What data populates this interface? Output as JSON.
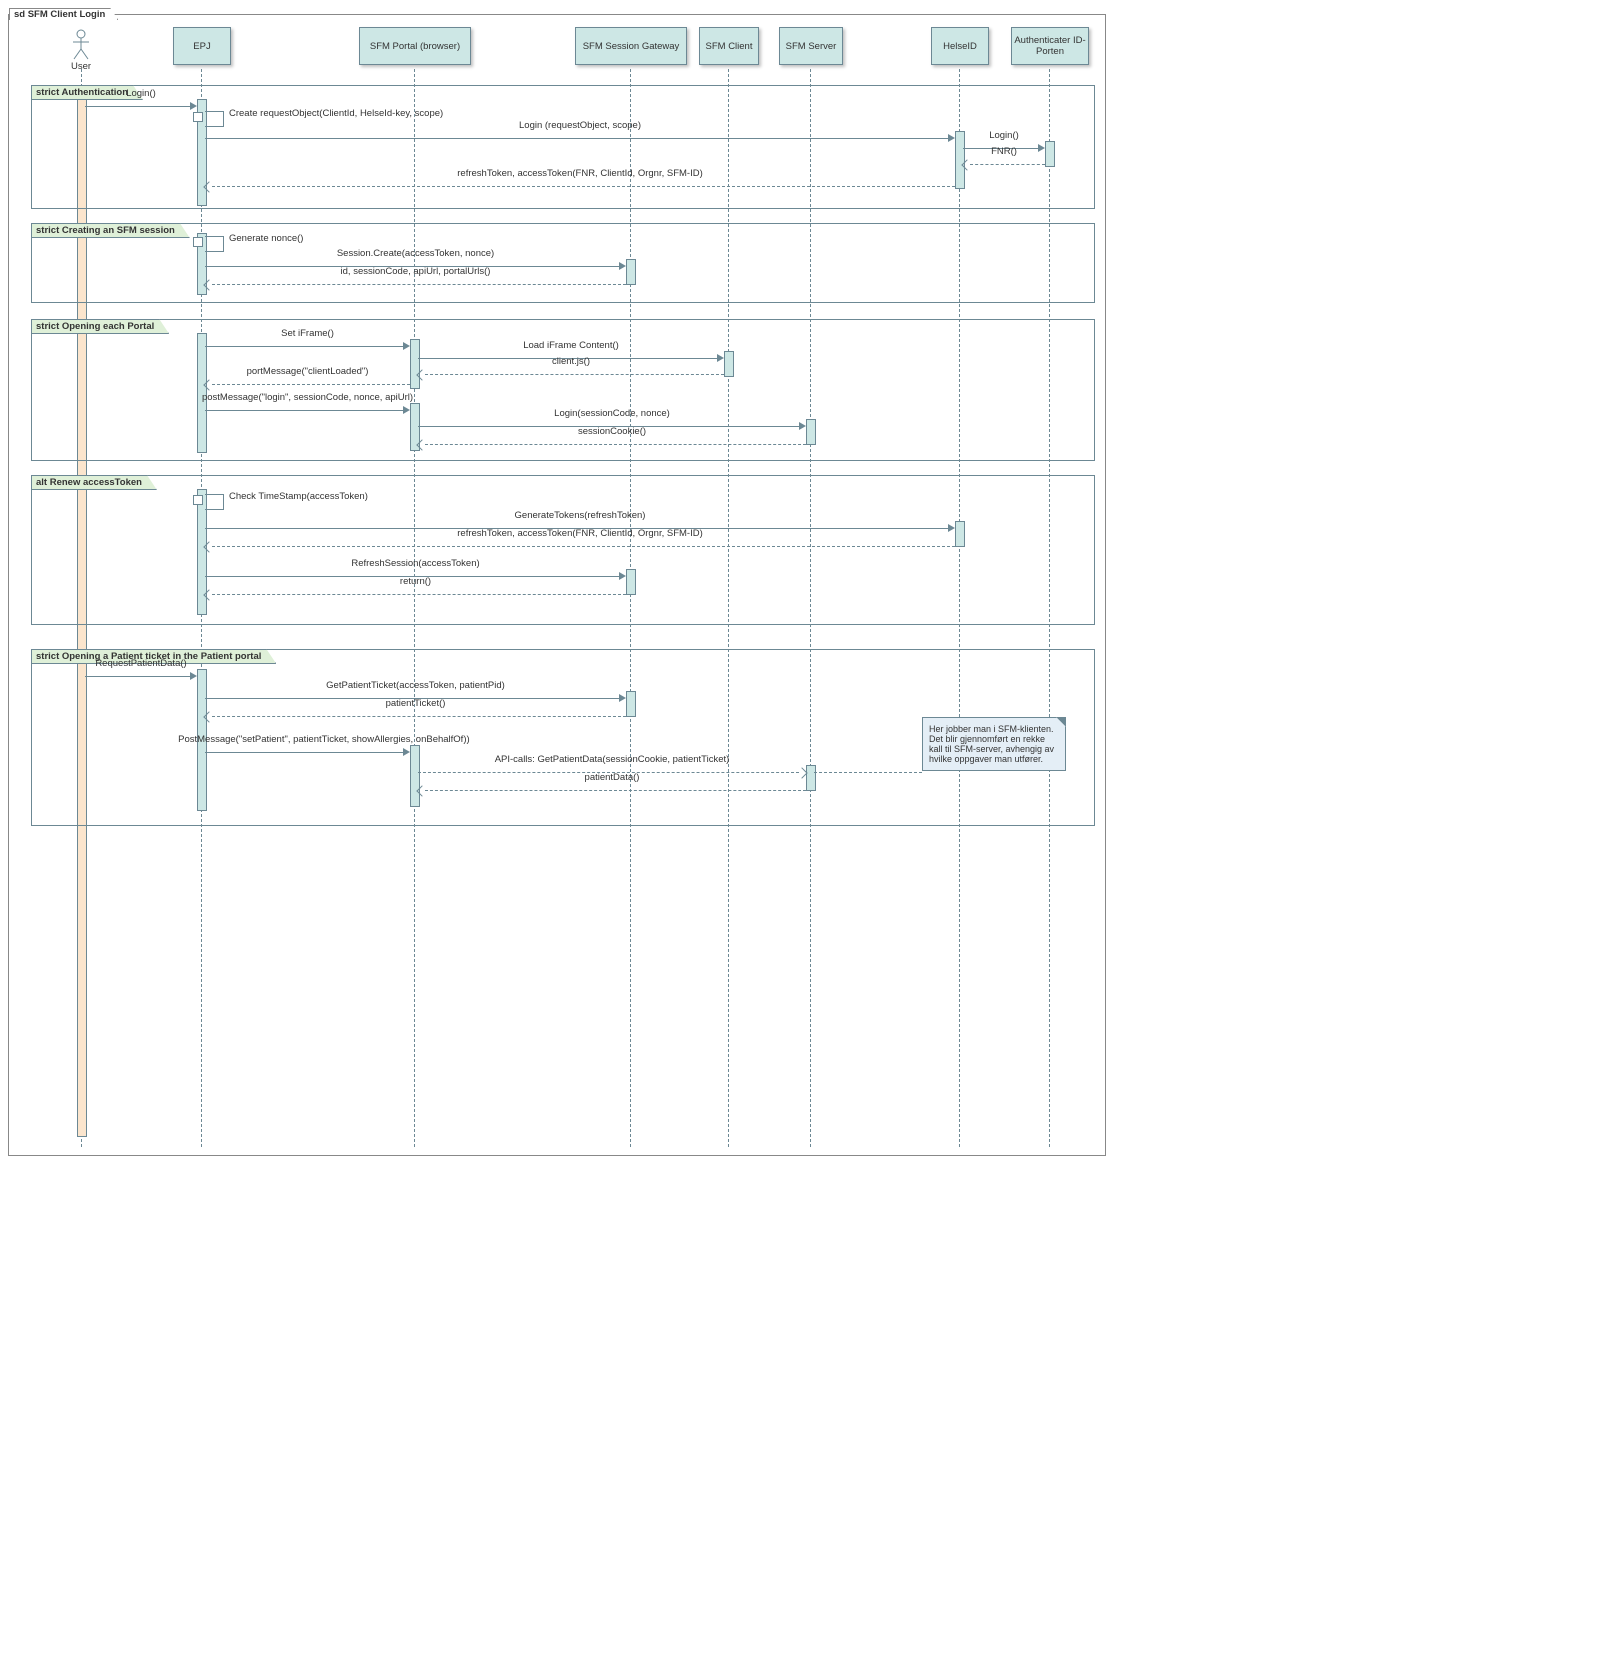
{
  "title": "sd SFM Client Login",
  "participants": {
    "user": {
      "label": "User"
    },
    "epj": {
      "label": "EPJ"
    },
    "portal": {
      "label": "SFM Portal (browser)"
    },
    "gateway": {
      "label": "SFM Session Gateway"
    },
    "client": {
      "label": "SFM Client"
    },
    "server": {
      "label": "SFM Server"
    },
    "helseid": {
      "label": "HelseID"
    },
    "idporten": {
      "label": "Authenticater ID-Porten"
    }
  },
  "fragments": {
    "auth": "strict Authentication",
    "create": "strict Creating an SFM session",
    "open": "strict Opening each Portal",
    "renew": "alt Renew accessToken",
    "patient": "strict Opening a Patient ticket in the Patient portal"
  },
  "messages": {
    "m1": "Login()",
    "m2": "Create requestObject(ClientId, HelseId-key, scope)",
    "m3": "Login (requestObject, scope)",
    "m4": "Login()",
    "m5": "FNR()",
    "m6": "refreshToken, accessToken(FNR, ClientId, Orgnr, SFM-ID)",
    "m7": "Generate nonce()",
    "m8": "Session.Create(accessToken, nonce)",
    "m9": "id, sessionCode, apiUrl, portalUrls()",
    "m10": "Set iFrame()",
    "m11": "Load iFrame Content()",
    "m12": "client.js()",
    "m13": "portMessage(\"clientLoaded\")",
    "m14": "postMessage(\"login\", sessionCode, nonce, apiUrl)",
    "m15": "Login(sessionCode, nonce)",
    "m16": "sessionCookie()",
    "m17": "Check TimeStamp(accessToken)",
    "m18": "GenerateTokens(refreshToken)",
    "m19": "refreshToken, accessToken(FNR, ClientId, Orgnr, SFM-ID)",
    "m20": "RefreshSession(accessToken)",
    "m21": "return()",
    "m22": "RequestPatientData()",
    "m23": "GetPatientTicket(accessToken, patientPid)",
    "m24": "patientTicket()",
    "m25": "PostMessage(\"setPatient\", patientTicket, showAllergies, onBehalfOf))",
    "m26": "API-calls: GetPatientData(sessionCookie, patientTicket)",
    "m27": "patientData()"
  },
  "note": "Her jobber man i SFM-klienten. Det blir gjennomført en rekke kall til SFM-server, avhengig av hvilke oppgaver man utfører."
}
